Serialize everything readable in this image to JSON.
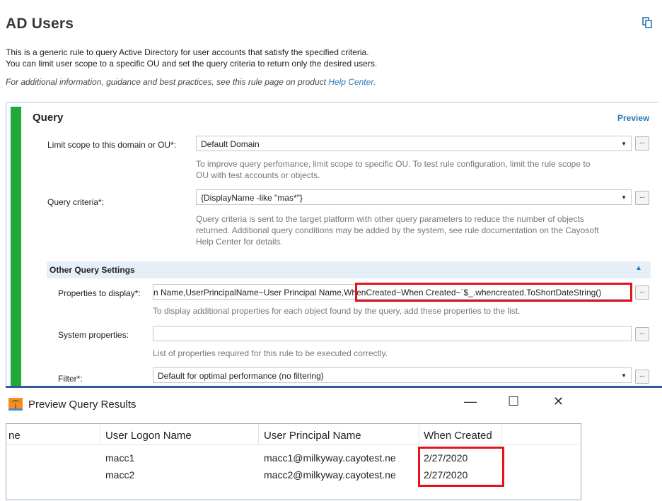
{
  "header": {
    "title": "AD Users",
    "description_line1": "This is a generic rule to query Active Directory for user accounts that satisfy the specified criteria.",
    "description_line2": "You can limit user scope to a specific OU and set the query criteria to return only the desired users.",
    "info_prefix": "For additional information, guidance and best practices, see this rule page on product ",
    "info_link": "Help Center",
    "info_suffix": "."
  },
  "query": {
    "title": "Query",
    "preview_label": "Preview",
    "scope": {
      "label": "Limit scope to this domain or OU*:",
      "value": "Default Domain",
      "hint_line1": "To improve query perfomance, limit scope to specific OU. To test rule configuration, limit the rule scope to",
      "hint_line2": "OU with test accounts or objects."
    },
    "criteria": {
      "label": "Query criteria*:",
      "value": "{DisplayName -like \"mas*\"}",
      "hint_line1": "Query criteria is sent to the target platform with other query parameters to reduce the number of objects",
      "hint_line2": "returned. Additional query conditions may be added by the system, see rule documentation on the Cayosoft",
      "hint_line3": "Help Center for details."
    },
    "browse_label": "..."
  },
  "other_settings": {
    "title": "Other Query Settings",
    "properties": {
      "label": "Properties to display*:",
      "value_part1": "n Name,UserPrincipalName~User Principal Name,",
      "value_part2": "WhenCreated~When Created~`$_.whencreated.ToShortDateString()",
      "hint": "To display additional properties for each object found by the query, add these properties to the list."
    },
    "system": {
      "label": "System properties:",
      "value": "",
      "hint": "List of properties required for this rule to be executed correctly."
    },
    "filter": {
      "label": "Filter*:",
      "value": "Default for optimal performance (no filtering)"
    }
  },
  "dialog": {
    "title": "Preview Query Results",
    "minimize": "—",
    "maximize": "☐",
    "close": "✕",
    "columns": [
      "ne",
      "User Logon Name",
      "User Principal Name",
      "When Created"
    ],
    "rows": [
      {
        "name": "",
        "logon": "macc1",
        "upn": "macc1@milkyway.cayotest.ne",
        "created": "2/27/2020"
      },
      {
        "name": "",
        "logon": "macc2",
        "upn": "macc2@milkyway.cayotest.ne",
        "created": "2/27/2020"
      }
    ]
  },
  "colors": {
    "accent_green": "#22a739",
    "link_blue": "#2a7ab8",
    "highlight_red": "#e3121b",
    "section_bg": "#e6eff8"
  }
}
